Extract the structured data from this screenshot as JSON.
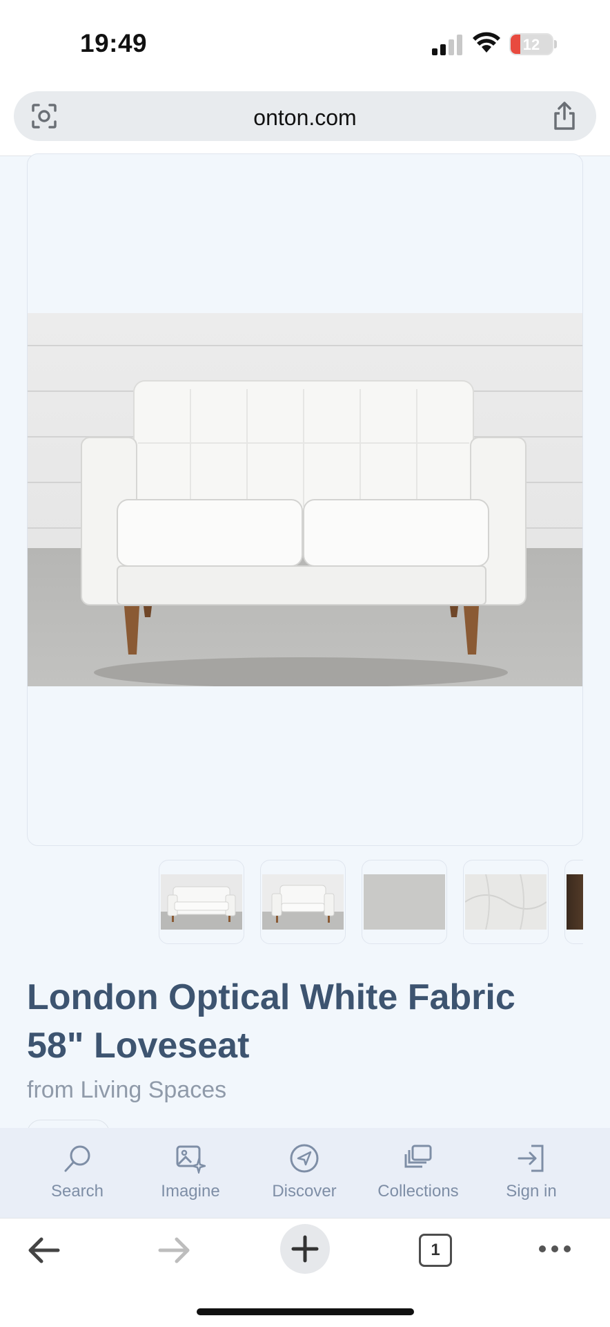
{
  "status_bar": {
    "time": "19:49",
    "battery_level": "12",
    "icons": [
      "signal-icon",
      "wifi-icon",
      "battery-icon"
    ]
  },
  "browser": {
    "url": "onton.com",
    "icons": [
      "lens-icon",
      "share-icon"
    ]
  },
  "product": {
    "title": "London Optical White Fabric 58\" Loveseat",
    "source": "from Living Spaces",
    "thumbnails": [
      {
        "name": "sofa-angle-view"
      },
      {
        "name": "sofa-front-view"
      },
      {
        "name": "fabric-swatch"
      },
      {
        "name": "tufting-detail"
      },
      {
        "name": "room-scene"
      }
    ]
  },
  "app_nav": {
    "items": [
      {
        "label": "Search",
        "icon": "search-icon"
      },
      {
        "label": "Imagine",
        "icon": "imagine-icon"
      },
      {
        "label": "Discover",
        "icon": "discover-icon"
      },
      {
        "label": "Collections",
        "icon": "collections-icon"
      },
      {
        "label": "Sign in",
        "icon": "sign-in-icon"
      }
    ]
  },
  "toolbar": {
    "tab_count": "1",
    "icons": [
      "back-arrow-icon",
      "forward-arrow-icon",
      "new-tab-plus-icon",
      "tabs-icon",
      "more-icon"
    ]
  },
  "colors": {
    "page_bg": "#f2f7fc",
    "title": "#3d5470",
    "muted": "#8f9aa9",
    "nav_bg": "#e9eef7",
    "nav_label": "#7e8ea6"
  }
}
